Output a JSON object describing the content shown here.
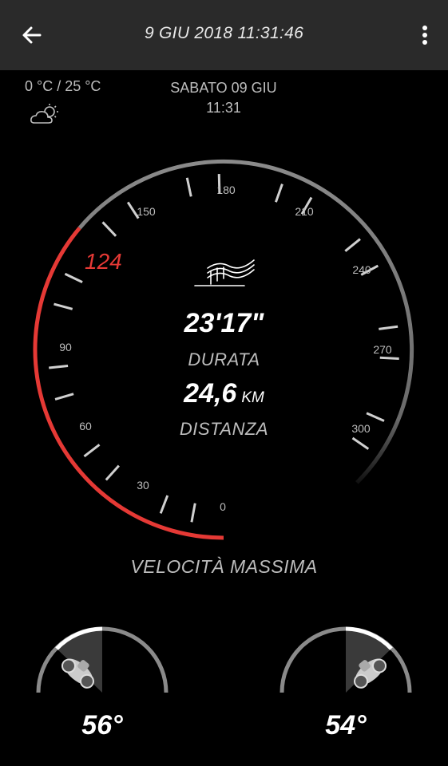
{
  "header": {
    "back_icon": "arrow-left-icon",
    "title": "9 GIU 2018 11:31:46",
    "menu_icon": "more-vert-icon"
  },
  "weather": {
    "temperature": "0 °C / 25 °C",
    "icon": "partly-cloudy-icon"
  },
  "date": {
    "day": "SABATO 09 GIU",
    "time": "11:31"
  },
  "speedometer": {
    "tick_labels": [
      "0",
      "30",
      "60",
      "90",
      "150",
      "180",
      "210",
      "240",
      "270",
      "300"
    ],
    "max_speed": "124",
    "max_speed_value": 124,
    "max_scale": 300,
    "accent_color": "#e53935",
    "ride_icon": "road-ride-icon"
  },
  "ride": {
    "duration": "23'17\"",
    "duration_label": "DURATA",
    "distance": "24,6",
    "distance_unit": "KM",
    "distance_label": "DISTANZA",
    "max_speed_label": "VELOCITÀ MASSIMA"
  },
  "lean": {
    "left": "56°",
    "right": "54°",
    "left_icon": "motorcycle-lean-left-icon",
    "right_icon": "motorcycle-lean-right-icon"
  }
}
